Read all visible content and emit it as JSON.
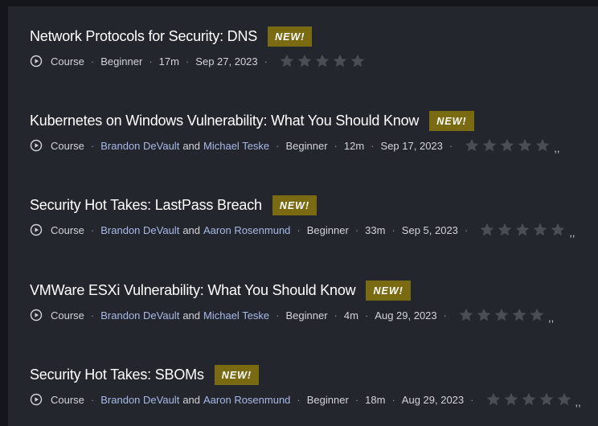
{
  "colors": {
    "background": "#14161c",
    "panel": "#23262d",
    "badge": "#7a6a12",
    "author_link": "#a9b9e6",
    "star_empty": "#4a4d54"
  },
  "icons": {
    "type": "play-circle-icon",
    "rating": "star-icon"
  },
  "items": [
    {
      "title": "Network Protocols for Security: DNS",
      "badge": "NEW!",
      "type": "Course",
      "authors": [],
      "author_joiner": "",
      "level": "Beginner",
      "duration": "17m",
      "date": "Sep 27, 2023",
      "rating": 0,
      "trailing": ""
    },
    {
      "title": "Kubernetes on Windows Vulnerability: What You Should Know",
      "badge": "NEW!",
      "type": "Course",
      "authors": [
        "Brandon DeVault",
        "Michael Teske"
      ],
      "author_joiner": "and",
      "level": "Beginner",
      "duration": "12m",
      "date": "Sep 17, 2023",
      "rating": 0,
      "trailing": ",,"
    },
    {
      "title": "Security Hot Takes: LastPass Breach",
      "badge": "NEW!",
      "type": "Course",
      "authors": [
        "Brandon DeVault",
        "Aaron Rosenmund"
      ],
      "author_joiner": "and",
      "level": "Beginner",
      "duration": "33m",
      "date": "Sep 5, 2023",
      "rating": 0,
      "trailing": ",,"
    },
    {
      "title": "VMWare ESXi Vulnerability: What You Should Know",
      "badge": "NEW!",
      "type": "Course",
      "authors": [
        "Brandon DeVault",
        "Michael Teske"
      ],
      "author_joiner": "and",
      "level": "Beginner",
      "duration": "4m",
      "date": "Aug 29, 2023",
      "rating": 0,
      "trailing": ",,"
    },
    {
      "title": "Security Hot Takes: SBOMs",
      "badge": "NEW!",
      "type": "Course",
      "authors": [
        "Brandon DeVault",
        "Aaron Rosenmund"
      ],
      "author_joiner": "and",
      "level": "Beginner",
      "duration": "18m",
      "date": "Aug 29, 2023",
      "rating": 0,
      "trailing": ",,"
    }
  ]
}
